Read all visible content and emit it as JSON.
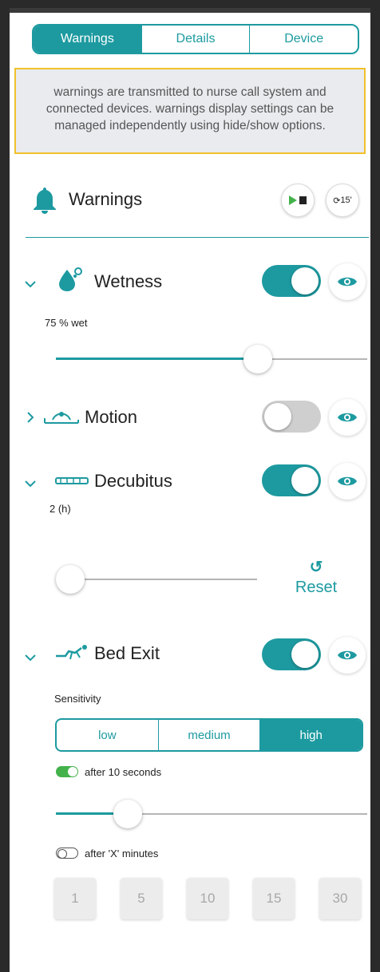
{
  "tabs": [
    {
      "label": "Warnings",
      "active": true
    },
    {
      "label": "Details",
      "active": false
    },
    {
      "label": "Device",
      "active": false
    }
  ],
  "notice": "warnings are transmitted to nurse call system and connected devices. warnings display settings can be managed independently using hide/show options.",
  "header": {
    "title": "Warnings",
    "timer_label": "15'"
  },
  "sections": {
    "wetness": {
      "title": "Wetness",
      "enabled": true,
      "value_label": "75 % wet",
      "slider_fraction": 0.65
    },
    "motion": {
      "title": "Motion",
      "enabled": false
    },
    "decubitus": {
      "title": "Decubitus",
      "enabled": true,
      "value_label": "2 (h)",
      "slider_fraction": 0.0,
      "reset_label": "Reset"
    },
    "bed_exit": {
      "title": "Bed Exit",
      "enabled": true,
      "sensitivity_label": "Sensitivity",
      "sensitivity_options": [
        "low",
        "medium",
        "high"
      ],
      "sensitivity_selected": "high",
      "after_seconds_label": "after 10 seconds",
      "after_seconds_enabled": true,
      "slider_fraction": 0.2,
      "after_minutes_label": "after 'X' minutes",
      "after_minutes_enabled": false,
      "minute_options": [
        "1",
        "5",
        "10",
        "15",
        "30"
      ]
    }
  },
  "colors": {
    "accent": "#1d9aa0",
    "notice_border": "#f0c12b",
    "mini_toggle_on": "#43b24b"
  }
}
